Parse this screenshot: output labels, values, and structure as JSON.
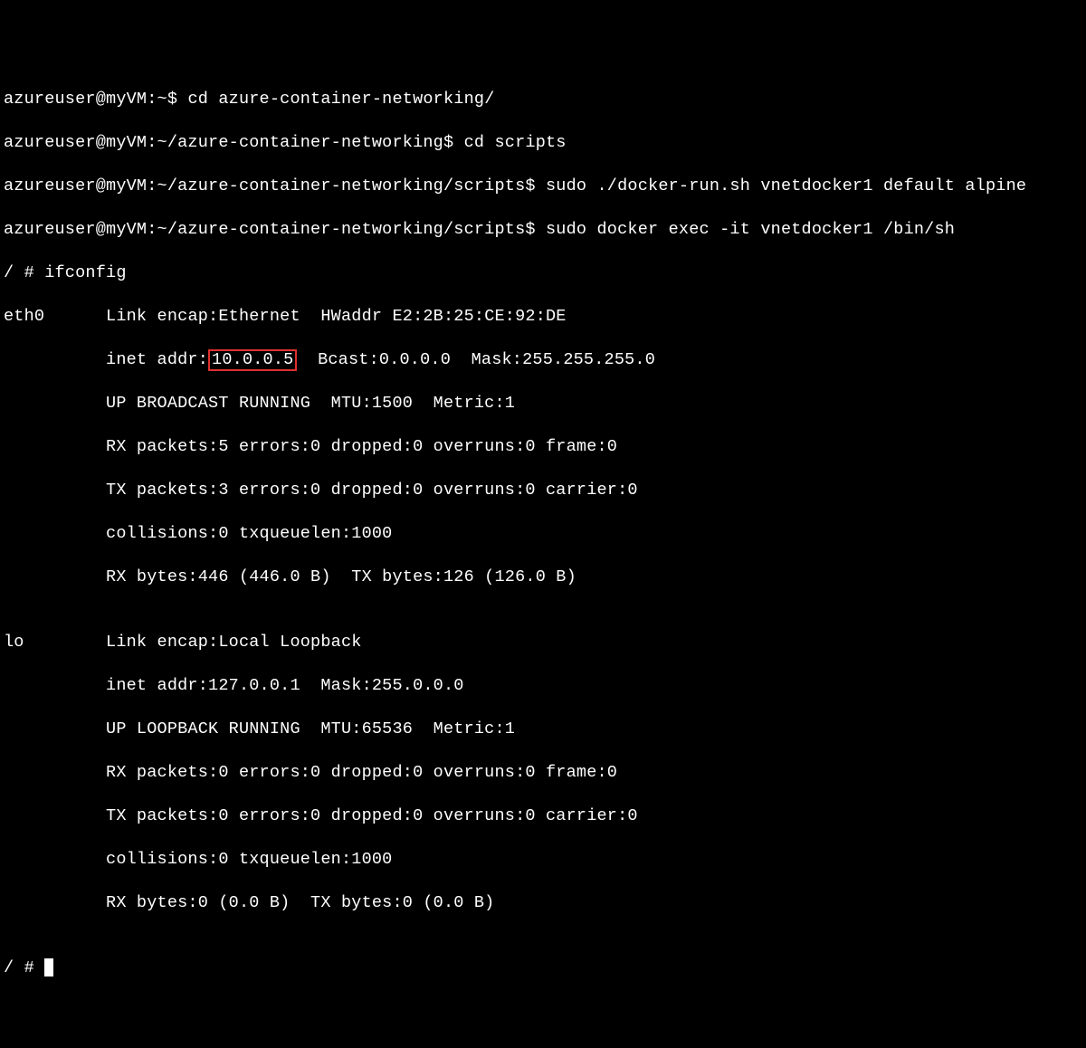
{
  "lines": {
    "l1_prompt": "azureuser@myVM:~$ ",
    "l1_cmd": "cd azure-container-networking/",
    "l2_prompt": "azureuser@myVM:~/azure-container-networking$ ",
    "l2_cmd": "cd scripts",
    "l3_prompt": "azureuser@myVM:~/azure-container-networking/scripts$ ",
    "l3_cmd": "sudo ./docker-run.sh vnetdocker1 default alpine",
    "l4_prompt": "azureuser@myVM:~/azure-container-networking/scripts$ ",
    "l4_cmd": "sudo docker exec -it vnetdocker1 /bin/sh",
    "l5": "/ # ifconfig",
    "eth0_name": "eth0",
    "eth0_l1": "      Link encap:Ethernet  HWaddr E2:2B:25:CE:92:DE",
    "eth0_l2a": "          inet addr:",
    "eth0_ip": "10.0.0.5",
    "eth0_l2b": "  Bcast:0.0.0.0  Mask:255.255.255.0",
    "eth0_l3": "          UP BROADCAST RUNNING  MTU:1500  Metric:1",
    "eth0_l4": "          RX packets:5 errors:0 dropped:0 overruns:0 frame:0",
    "eth0_l5": "          TX packets:3 errors:0 dropped:0 overruns:0 carrier:0",
    "eth0_l6": "          collisions:0 txqueuelen:1000",
    "eth0_l7": "          RX bytes:446 (446.0 B)  TX bytes:126 (126.0 B)",
    "blank": "",
    "lo_name": "lo",
    "lo_l1": "        Link encap:Local Loopback",
    "lo_l2": "          inet addr:127.0.0.1  Mask:255.0.0.0",
    "lo_l3": "          UP LOOPBACK RUNNING  MTU:65536  Metric:1",
    "lo_l4": "          RX packets:0 errors:0 dropped:0 overruns:0 frame:0",
    "lo_l5": "          TX packets:0 errors:0 dropped:0 overruns:0 carrier:0",
    "lo_l6": "          collisions:0 txqueuelen:1000",
    "lo_l7": "          RX bytes:0 (0.0 B)  TX bytes:0 (0.0 B)",
    "final_prompt": "/ # "
  },
  "highlight_color": "#e03030"
}
